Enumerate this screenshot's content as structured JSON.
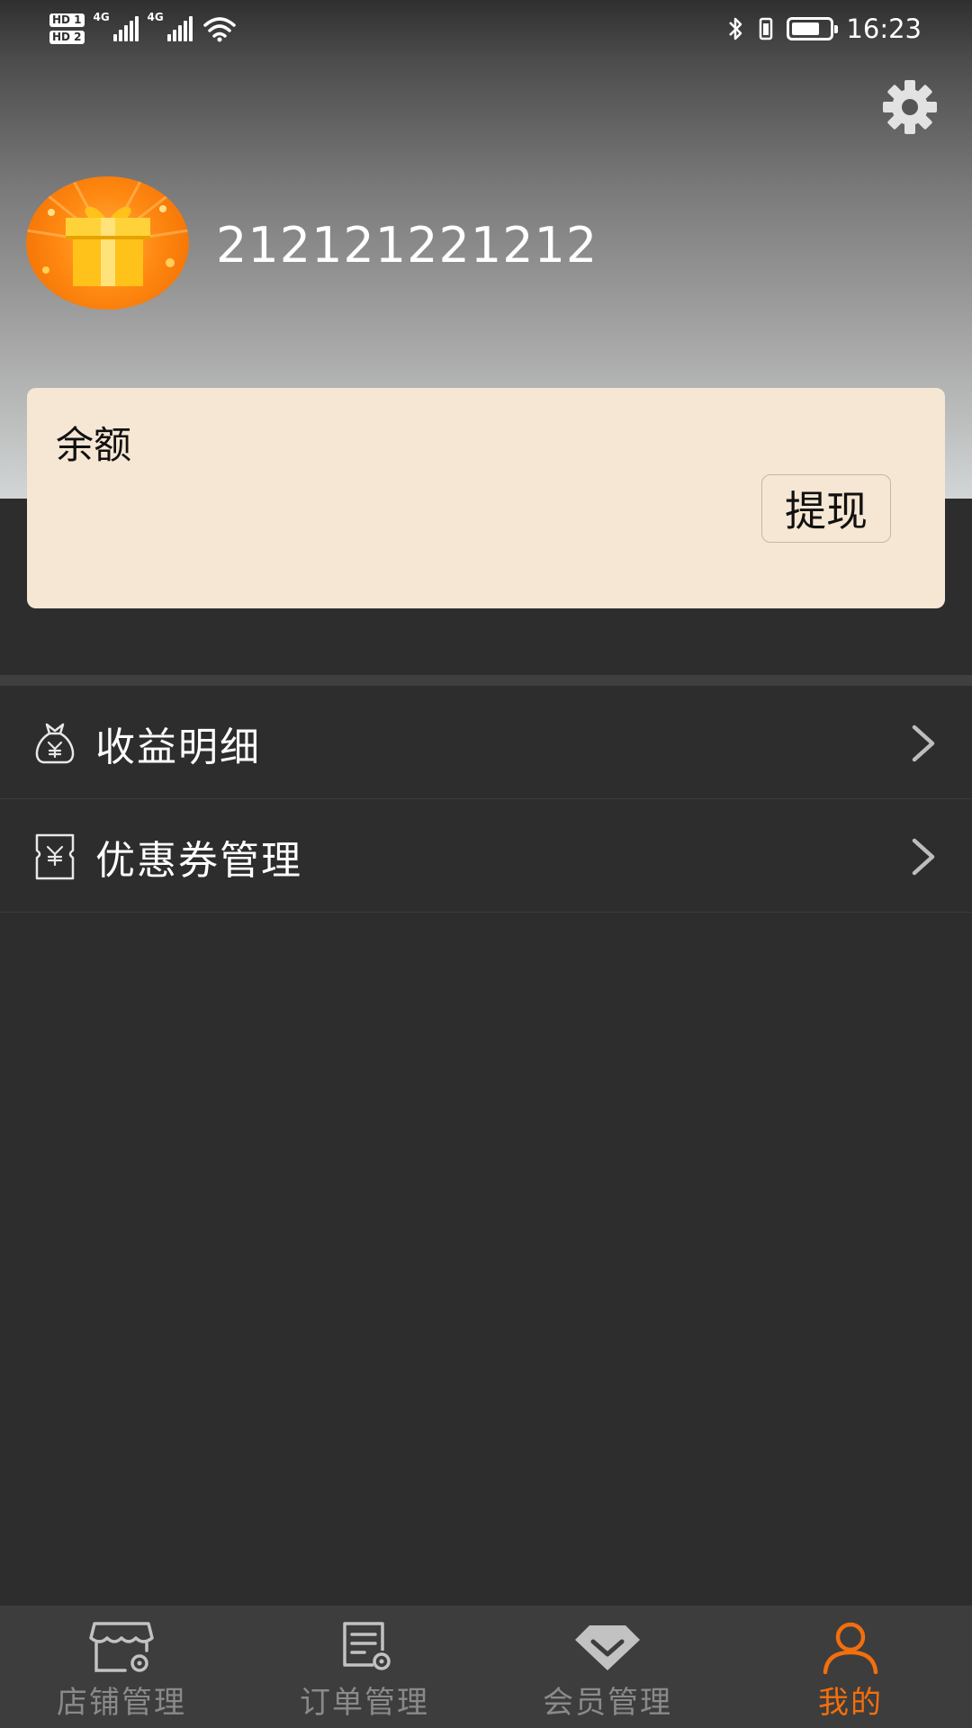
{
  "status_bar": {
    "hd1": "HD 1",
    "hd2": "HD 2",
    "net1": "4G",
    "net2": "4G",
    "battery_level": 0.75,
    "time": "16:23"
  },
  "profile": {
    "username": "212121221212",
    "avatar_icon": "gift-box-icon"
  },
  "balance": {
    "label": "余额",
    "withdraw_label": "提现"
  },
  "menu": {
    "items": [
      {
        "label": "收益明细",
        "icon": "money-bag-icon"
      },
      {
        "label": "优惠券管理",
        "icon": "coupon-icon"
      }
    ]
  },
  "tabs": [
    {
      "label": "店铺管理",
      "icon": "store-settings-icon"
    },
    {
      "label": "订单管理",
      "icon": "order-settings-icon"
    },
    {
      "label": "会员管理",
      "icon": "member-diamond-icon"
    },
    {
      "label": "我的",
      "icon": "person-icon"
    }
  ],
  "colors": {
    "accent": "#f26f0e",
    "background": "#2d2d2d",
    "card": "#f6e7d4",
    "tabbar": "#3d3d3d"
  }
}
